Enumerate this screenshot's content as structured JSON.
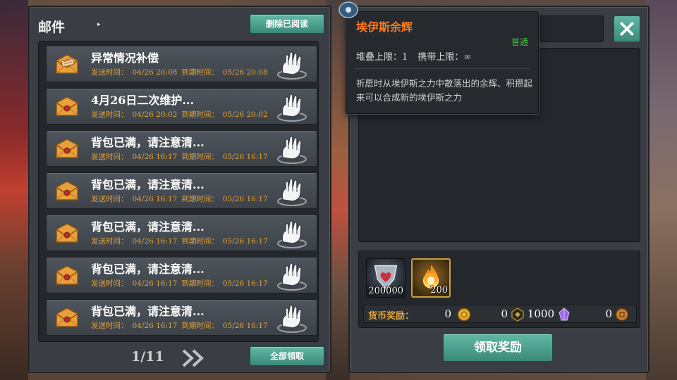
{
  "mail_panel": {
    "title": "邮件",
    "delete_read_label": "删除已阅读",
    "claim_all_label": "全部领取",
    "page_indicator": "1/11",
    "mails": [
      {
        "title": "异常情况补偿",
        "sent_label": "发送时间：",
        "sent": "04/26 20:08",
        "expire_label": "到期时间：",
        "expire": "05/26 20:08",
        "opened": true
      },
      {
        "title": "4月26日二次维护...",
        "sent_label": "发送时间：",
        "sent": "04/26 20:02",
        "expire_label": "到期时间：",
        "expire": "05/26 20:02",
        "opened": false
      },
      {
        "title": "背包已满，请注意清...",
        "sent_label": "发送时间：",
        "sent": "04/26 16:17",
        "expire_label": "到期时间：",
        "expire": "05/26 16:17",
        "opened": false
      },
      {
        "title": "背包已满，请注意清...",
        "sent_label": "发送时间：",
        "sent": "04/26 16:17",
        "expire_label": "到期时间：",
        "expire": "05/26 16:17",
        "opened": false
      },
      {
        "title": "背包已满，请注意清...",
        "sent_label": "发送时间：",
        "sent": "04/26 16:17",
        "expire_label": "到期时间：",
        "expire": "05/26 16:17",
        "opened": false
      },
      {
        "title": "背包已满，请注意清...",
        "sent_label": "发送时间：",
        "sent": "04/26 16:17",
        "expire_label": "到期时间：",
        "expire": "05/26 16:17",
        "opened": false
      },
      {
        "title": "背包已满，请注意清...",
        "sent_label": "发送时间：",
        "sent": "04/26 16:17",
        "expire_label": "到期时间：",
        "expire": "05/26 16:17",
        "opened": false
      }
    ]
  },
  "tooltip": {
    "name": "埃伊斯余辉",
    "rarity": "普通",
    "stack_limit": "堆叠上限：1",
    "carry_limit": "携带上限：∞",
    "description": "祈愿时从埃伊斯之力中散落出的余辉、积攒起来可以合成新的埃伊斯之力"
  },
  "reward_panel": {
    "items": [
      {
        "icon": "heart-crest-icon",
        "count": "200000"
      },
      {
        "icon": "flame-orb-icon",
        "count": "200"
      }
    ],
    "currency_label": "货币奖励：",
    "currencies": [
      {
        "icon": "gold-coin-icon",
        "value": "0"
      },
      {
        "icon": "dark-crest-icon",
        "value": "0"
      },
      {
        "icon": "purple-crystal-icon",
        "value": "1000"
      },
      {
        "icon": "bronze-coin-icon",
        "value": "0"
      }
    ],
    "claim_label": "领取奖励"
  },
  "colors": {
    "accent_green": "#4aa08c",
    "meta_orange": "#e2a23a",
    "tooltip_title": "#ff7a1a",
    "rarity_common": "#3ec83a"
  }
}
